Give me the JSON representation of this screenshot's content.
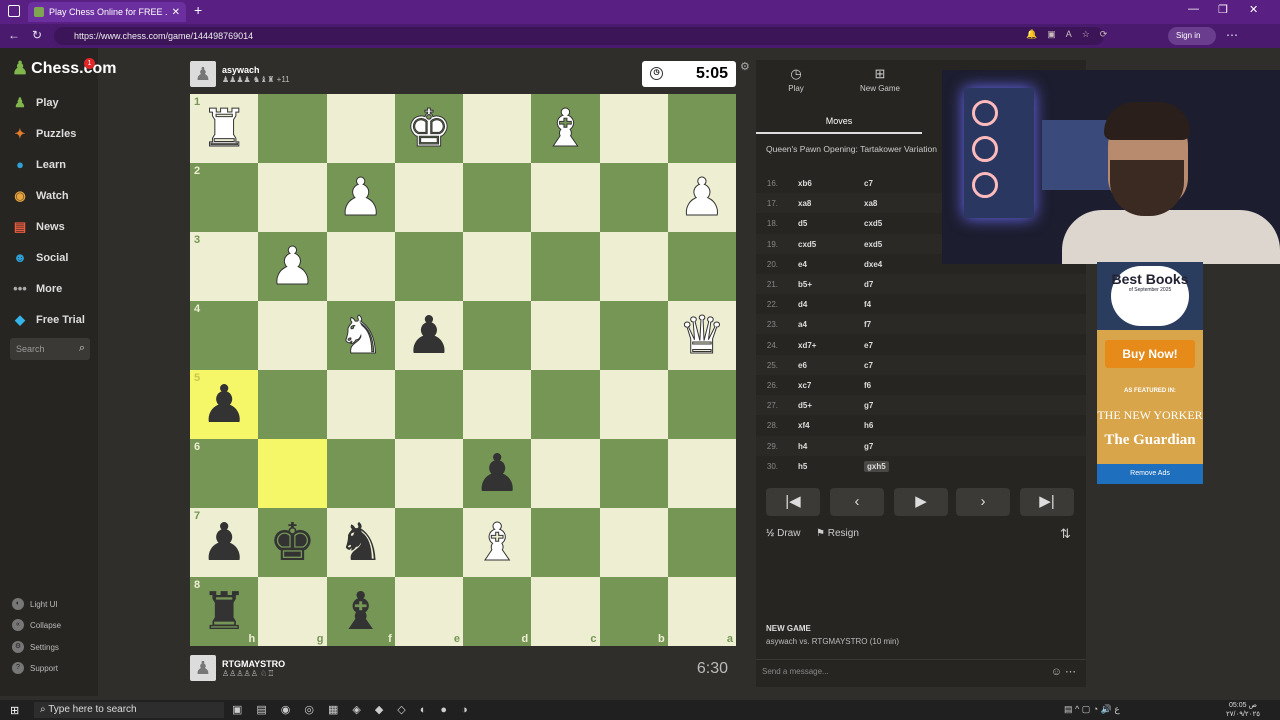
{
  "browser": {
    "tab_title": "Play Chess Online for FREE ...",
    "url": "https://www.chess.com/game/144498769014",
    "sign_in": "Sign in"
  },
  "sidebar": {
    "logo": "Chess.com",
    "notif_count": "1",
    "items": [
      {
        "label": "Play",
        "icon": "play-icon",
        "color": "#81b64c"
      },
      {
        "label": "Puzzles",
        "icon": "puzzle-icon",
        "color": "#e27c2a"
      },
      {
        "label": "Learn",
        "icon": "learn-icon",
        "color": "#2ea0d6"
      },
      {
        "label": "Watch",
        "icon": "watch-icon",
        "color": "#e8a33d"
      },
      {
        "label": "News",
        "icon": "news-icon",
        "color": "#e85a3d"
      },
      {
        "label": "Social",
        "icon": "social-icon",
        "color": "#2ea0d6"
      },
      {
        "label": "More",
        "icon": "more-icon",
        "color": "#aaaaaa"
      },
      {
        "label": "Free Trial",
        "icon": "diamond-icon",
        "color": "#36b3e8"
      }
    ],
    "search_placeholder": "Search",
    "bottom": [
      "Light UI",
      "Collapse",
      "Settings",
      "Support"
    ]
  },
  "top_player": {
    "name": "asywach",
    "captured": "+11",
    "clock": "5:05"
  },
  "bottom_player": {
    "name": "RTGMAYSTRO",
    "clock": "6:30"
  },
  "board": {
    "ranks": [
      "1",
      "2",
      "3",
      "4",
      "5",
      "6",
      "7",
      "8"
    ],
    "files": [
      "h",
      "g",
      "f",
      "e",
      "d",
      "c",
      "b",
      "a"
    ],
    "rows": [
      [
        "wR",
        "",
        "",
        "wK",
        "",
        "wB",
        "",
        ""
      ],
      [
        "",
        "",
        "wP",
        "",
        "",
        "",
        "",
        "wP"
      ],
      [
        "",
        "wP",
        "",
        "",
        "",
        "",
        "",
        ""
      ],
      [
        "",
        "",
        "wN",
        "bP",
        "",
        "",
        "",
        "wQ"
      ],
      [
        "bP",
        "",
        "",
        "",
        "",
        "",
        "",
        ""
      ],
      [
        "",
        "",
        "",
        "",
        "bP",
        "",
        "",
        ""
      ],
      [
        "bP",
        "bK",
        "bN",
        "",
        "wB",
        "",
        "",
        ""
      ],
      [
        "bR",
        "",
        "bB",
        "",
        "",
        "",
        "",
        ""
      ]
    ],
    "highlight": [
      [
        4,
        0
      ],
      [
        5,
        1
      ]
    ]
  },
  "panel": {
    "tabs": [
      "Play",
      "New Game"
    ],
    "moves_tab": "Moves",
    "opening": "Queen's Pawn Opening: Tartakower Variation",
    "moves": [
      {
        "no": "16.",
        "w": "xb6",
        "b": "c7"
      },
      {
        "no": "17.",
        "w": "xa8",
        "b": "xa8"
      },
      {
        "no": "18.",
        "w": "d5",
        "b": "cxd5"
      },
      {
        "no": "19.",
        "w": "cxd5",
        "b": "exd5"
      },
      {
        "no": "20.",
        "w": "e4",
        "b": "dxe4"
      },
      {
        "no": "21.",
        "w": "b5+",
        "b": "d7"
      },
      {
        "no": "22.",
        "w": "d4",
        "b": "f4"
      },
      {
        "no": "23.",
        "w": "a4",
        "b": "f7"
      },
      {
        "no": "24.",
        "w": "xd7+",
        "b": "e7"
      },
      {
        "no": "25.",
        "w": "e6",
        "b": "c7"
      },
      {
        "no": "26.",
        "w": "xc7",
        "b": "f6"
      },
      {
        "no": "27.",
        "w": "d5+",
        "b": "g7"
      },
      {
        "no": "28.",
        "w": "xf4",
        "b": "h6"
      },
      {
        "no": "29.",
        "w": "h4",
        "b": "g7"
      },
      {
        "no": "30.",
        "w": "h5",
        "b": "gxh5"
      }
    ],
    "draw": "Draw",
    "half": "½",
    "resign": "Resign",
    "new_game_title": "NEW GAME",
    "new_game_sub": "asywach vs. RTGMAYSTRO (10 min)",
    "message_placeholder": "Send a message..."
  },
  "ad": {
    "badge_big": "Best Books",
    "badge_small": "of September 2025",
    "buy": "Buy Now!",
    "featured": "AS FEATURED IN:",
    "ny": "THE NEW YORKER",
    "guardian": "The Guardian",
    "remove": "Remove Ads"
  },
  "taskbar": {
    "search": "Type here to search",
    "time": "05:05 ص",
    "date": "٢٧/٠٩/٢٠٢٥"
  }
}
